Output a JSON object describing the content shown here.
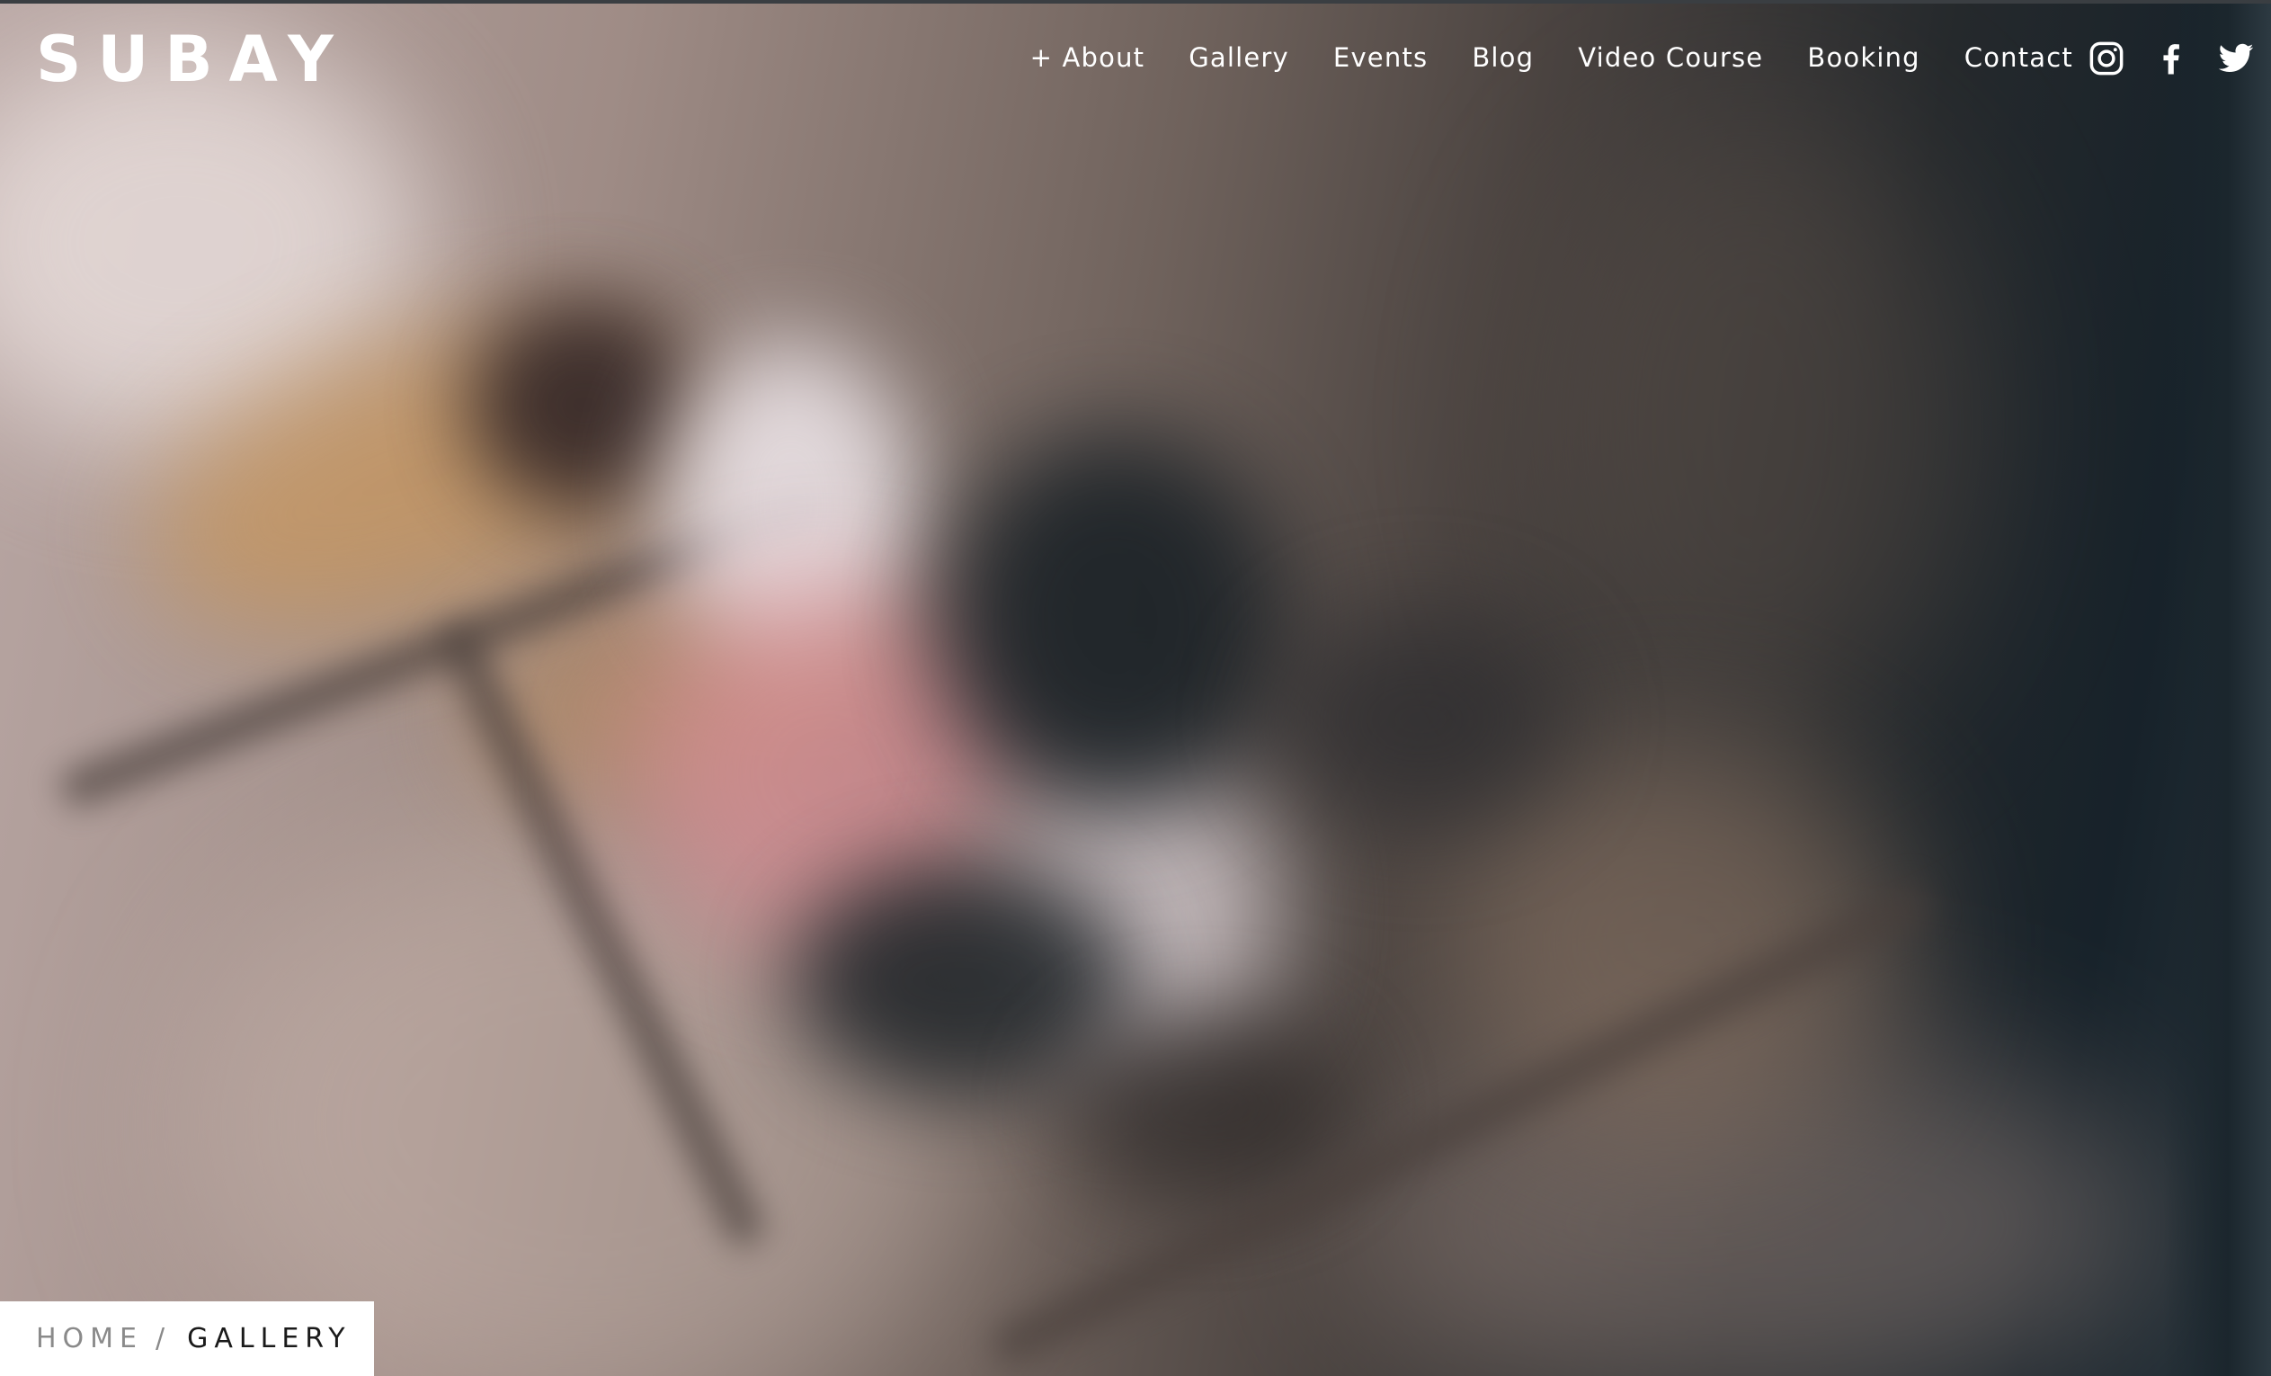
{
  "site": {
    "logo": "SUBAY"
  },
  "nav": {
    "items": [
      {
        "label": "+ About"
      },
      {
        "label": "Gallery"
      },
      {
        "label": "Events"
      },
      {
        "label": "Blog"
      },
      {
        "label": "Video Course"
      },
      {
        "label": "Booking"
      },
      {
        "label": "Contact"
      }
    ]
  },
  "social": {
    "icons": [
      "instagram-icon",
      "facebook-icon",
      "twitter-icon"
    ],
    "color": "#ffffff"
  },
  "breadcrumb": {
    "home": "HOME",
    "separator": "/",
    "current": "GALLERY"
  },
  "hero": {
    "style": "blurred photo background",
    "dominant_colors": [
      "#b9a7a4",
      "#c59661",
      "#d98f96",
      "#17222a"
    ]
  }
}
